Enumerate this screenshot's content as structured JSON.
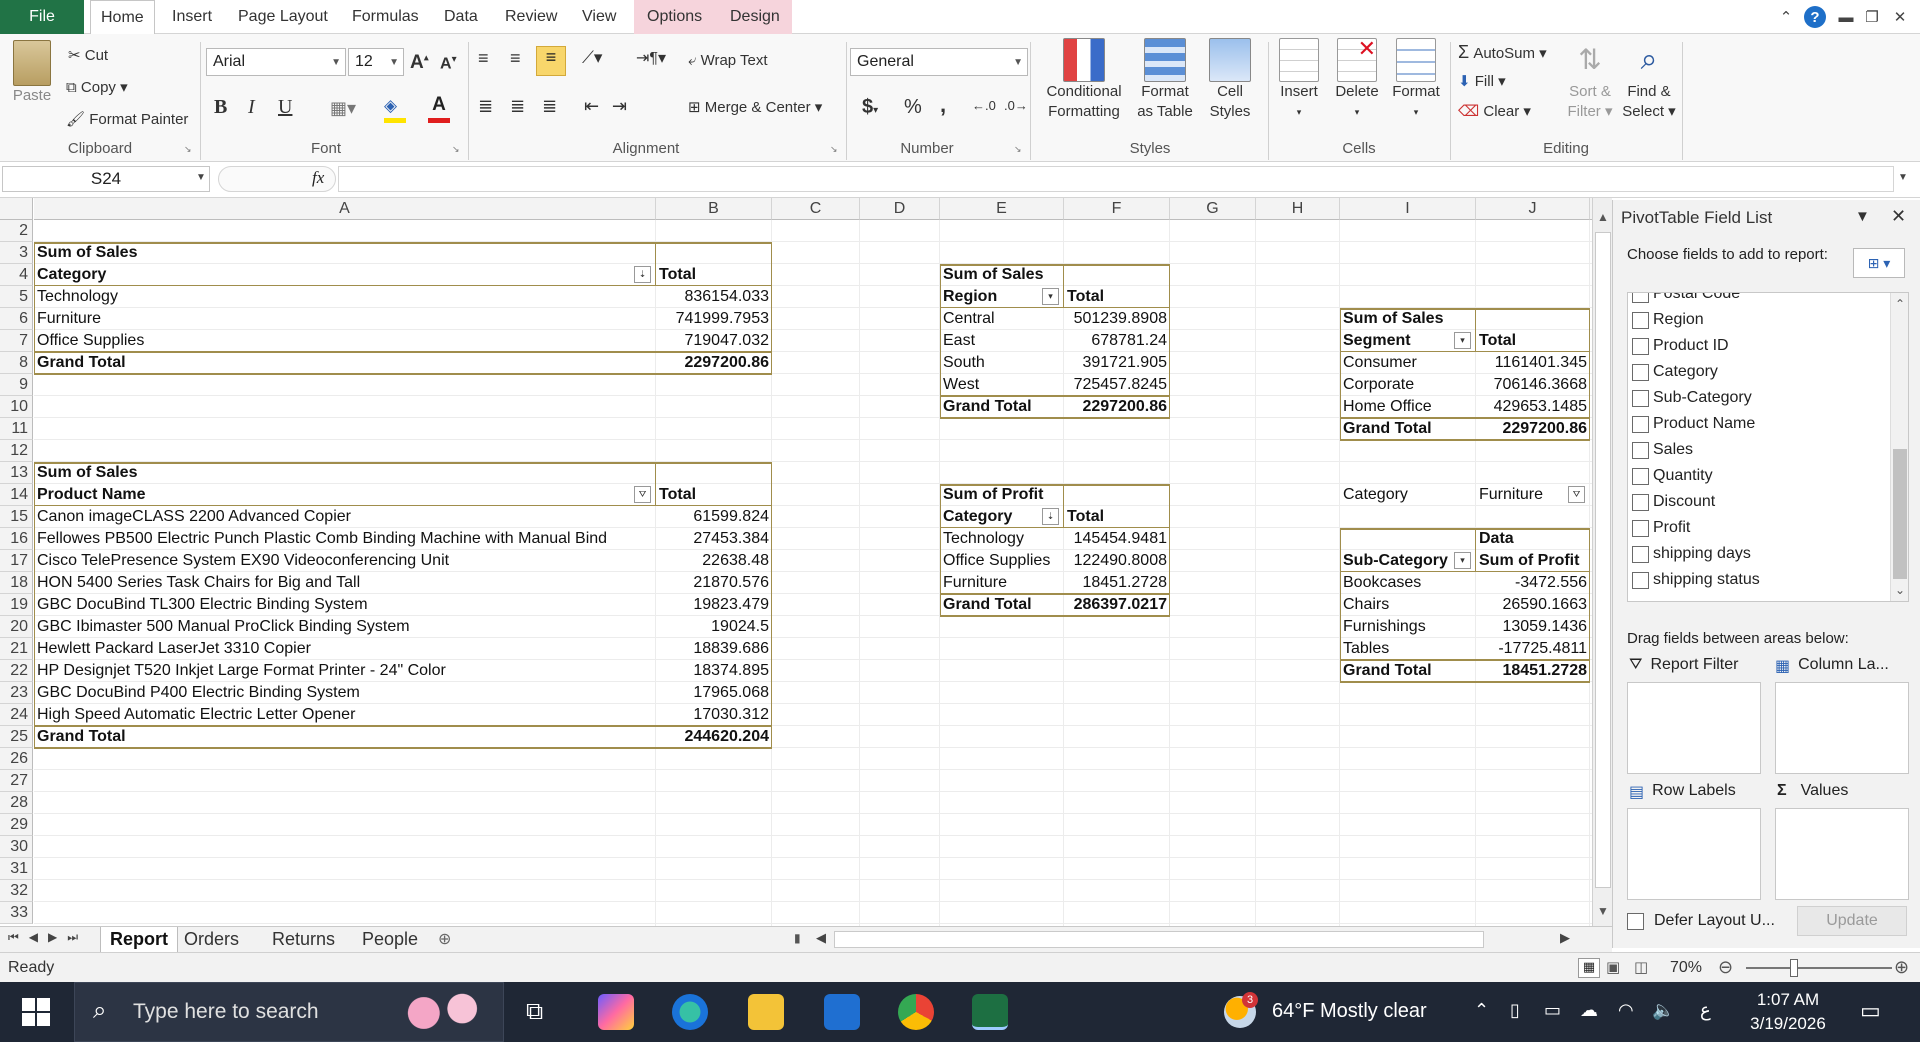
{
  "menu": {
    "file": "File",
    "tabs": [
      "Home",
      "Insert",
      "Page Layout",
      "Formulas",
      "Data",
      "Review",
      "View"
    ],
    "context_tabs": [
      "Options",
      "Design"
    ]
  },
  "ribbon": {
    "clipboard": {
      "paste": "Paste",
      "cut": "Cut",
      "copy": "Copy",
      "format_painter": "Format Painter",
      "label": "Clipboard"
    },
    "font": {
      "name": "Arial",
      "size": "12",
      "bold": "B",
      "italic": "I",
      "underline": "U",
      "label": "Font"
    },
    "alignment": {
      "wrap_text": "Wrap Text",
      "merge_center": "Merge & Center",
      "label": "Alignment"
    },
    "number": {
      "format": "General",
      "currency": "$",
      "percent": "%",
      "comma": ",",
      "label": "Number"
    },
    "styles": {
      "conditional_1": "Conditional",
      "conditional_2": "Formatting",
      "format_table_1": "Format",
      "format_table_2": "as Table",
      "cell_styles_1": "Cell",
      "cell_styles_2": "Styles",
      "label": "Styles"
    },
    "cells": {
      "insert": "Insert",
      "delete": "Delete",
      "format": "Format",
      "label": "Cells"
    },
    "editing": {
      "autosum": "AutoSum",
      "fill": "Fill",
      "clear": "Clear",
      "sort_1": "Sort &",
      "sort_2": "Filter",
      "find_1": "Find &",
      "find_2": "Select",
      "label": "Editing"
    }
  },
  "formula_bar": {
    "name_box": "S24",
    "fx": "fx",
    "value": ""
  },
  "columns": [
    "A",
    "B",
    "C",
    "D",
    "E",
    "F",
    "G",
    "H",
    "I",
    "J"
  ],
  "rows": [
    "2",
    "3",
    "4",
    "5",
    "6",
    "7",
    "8",
    "9",
    "10",
    "11",
    "12",
    "13",
    "14",
    "15",
    "16",
    "17",
    "18",
    "19",
    "20",
    "21",
    "22",
    "23",
    "24",
    "25",
    "26",
    "27",
    "28",
    "29",
    "30",
    "31",
    "32",
    "33"
  ],
  "pivot_category": {
    "title": "Sum of Sales",
    "h1": "Category",
    "h2": "Total",
    "rows": [
      [
        "Technology",
        "836154.033"
      ],
      [
        "Furniture",
        "741999.7953"
      ],
      [
        "Office Supplies",
        "719047.032"
      ]
    ],
    "grand": [
      "Grand Total",
      "2297200.86"
    ]
  },
  "pivot_product": {
    "title": "Sum of Sales",
    "h1": "Product Name",
    "h2": "Total",
    "rows": [
      [
        "Canon imageCLASS 2200 Advanced Copier",
        "61599.824"
      ],
      [
        "Fellowes PB500 Electric Punch Plastic Comb Binding Machine with Manual Bind",
        "27453.384"
      ],
      [
        "Cisco TelePresence System EX90 Videoconferencing Unit",
        "22638.48"
      ],
      [
        "HON 5400 Series Task Chairs for Big and Tall",
        "21870.576"
      ],
      [
        "GBC DocuBind TL300 Electric Binding System",
        "19823.479"
      ],
      [
        "GBC Ibimaster 500 Manual ProClick Binding System",
        "19024.5"
      ],
      [
        "Hewlett Packard LaserJet 3310 Copier",
        "18839.686"
      ],
      [
        "HP Designjet T520 Inkjet Large Format Printer - 24\" Color",
        "18374.895"
      ],
      [
        "GBC DocuBind P400 Electric Binding System",
        "17965.068"
      ],
      [
        "High Speed Automatic Electric Letter Opener",
        "17030.312"
      ]
    ],
    "grand": [
      "Grand Total",
      "244620.204"
    ]
  },
  "pivot_region": {
    "title": "Sum of Sales",
    "h1": "Region",
    "h2": "Total",
    "rows": [
      [
        "Central",
        "501239.8908"
      ],
      [
        "East",
        "678781.24"
      ],
      [
        "South",
        "391721.905"
      ],
      [
        "West",
        "725457.8245"
      ]
    ],
    "grand": [
      "Grand Total",
      "2297200.86"
    ]
  },
  "pivot_profit": {
    "title": "Sum of Profit",
    "h1": "Category",
    "h2": "Total",
    "rows": [
      [
        "Technology",
        "145454.9481"
      ],
      [
        "Office Supplies",
        "122490.8008"
      ],
      [
        "Furniture",
        "18451.2728"
      ]
    ],
    "grand": [
      "Grand Total",
      "286397.0217"
    ]
  },
  "pivot_segment": {
    "title": "Sum of Sales",
    "h1": "Segment",
    "h2": "Total",
    "rows": [
      [
        "Consumer",
        "1161401.345"
      ],
      [
        "Corporate",
        "706146.3668"
      ],
      [
        "Home Office",
        "429653.1485"
      ]
    ],
    "grand": [
      "Grand Total",
      "2297200.86"
    ]
  },
  "pivot_subcat": {
    "filter_label": "Category",
    "filter_value": "Furniture",
    "data_label": "Data",
    "h1": "Sub-Category",
    "h2": "Sum of Profit",
    "rows": [
      [
        "Bookcases",
        "-3472.556"
      ],
      [
        "Chairs",
        "26590.1663"
      ],
      [
        "Furnishings",
        "13059.1436"
      ],
      [
        "Tables",
        "-17725.4811"
      ]
    ],
    "grand": [
      "Grand Total",
      "18451.2728"
    ]
  },
  "field_list": {
    "title": "PivotTable Field List",
    "choose": "Choose fields to add to report:",
    "fields": [
      "Postal Code",
      "Region",
      "Product ID",
      "Category",
      "Sub-Category",
      "Product Name",
      "Sales",
      "Quantity",
      "Discount",
      "Profit",
      "shipping days",
      "shipping status"
    ],
    "drag": "Drag fields between areas below:",
    "report_filter": "Report Filter",
    "column_labels": "Column La...",
    "row_labels": "Row Labels",
    "values": "Values",
    "defer": "Defer Layout U...",
    "update": "Update"
  },
  "sheets": {
    "tabs": [
      "Report",
      "Orders",
      "Returns",
      "People"
    ],
    "active": "Report"
  },
  "status": {
    "ready": "Ready",
    "zoom": "70%"
  },
  "taskbar": {
    "search": "Type here to search",
    "weather": "64°F  Mostly clear",
    "lang": "ع",
    "time": "1:07 AM",
    "date": "3/19/2026",
    "badge": "3"
  },
  "colors": {
    "excel_green": "#217346",
    "pivot_border": "#a08d4c",
    "context_tab": "#f6d4dc",
    "taskbar": "#1f2735"
  }
}
